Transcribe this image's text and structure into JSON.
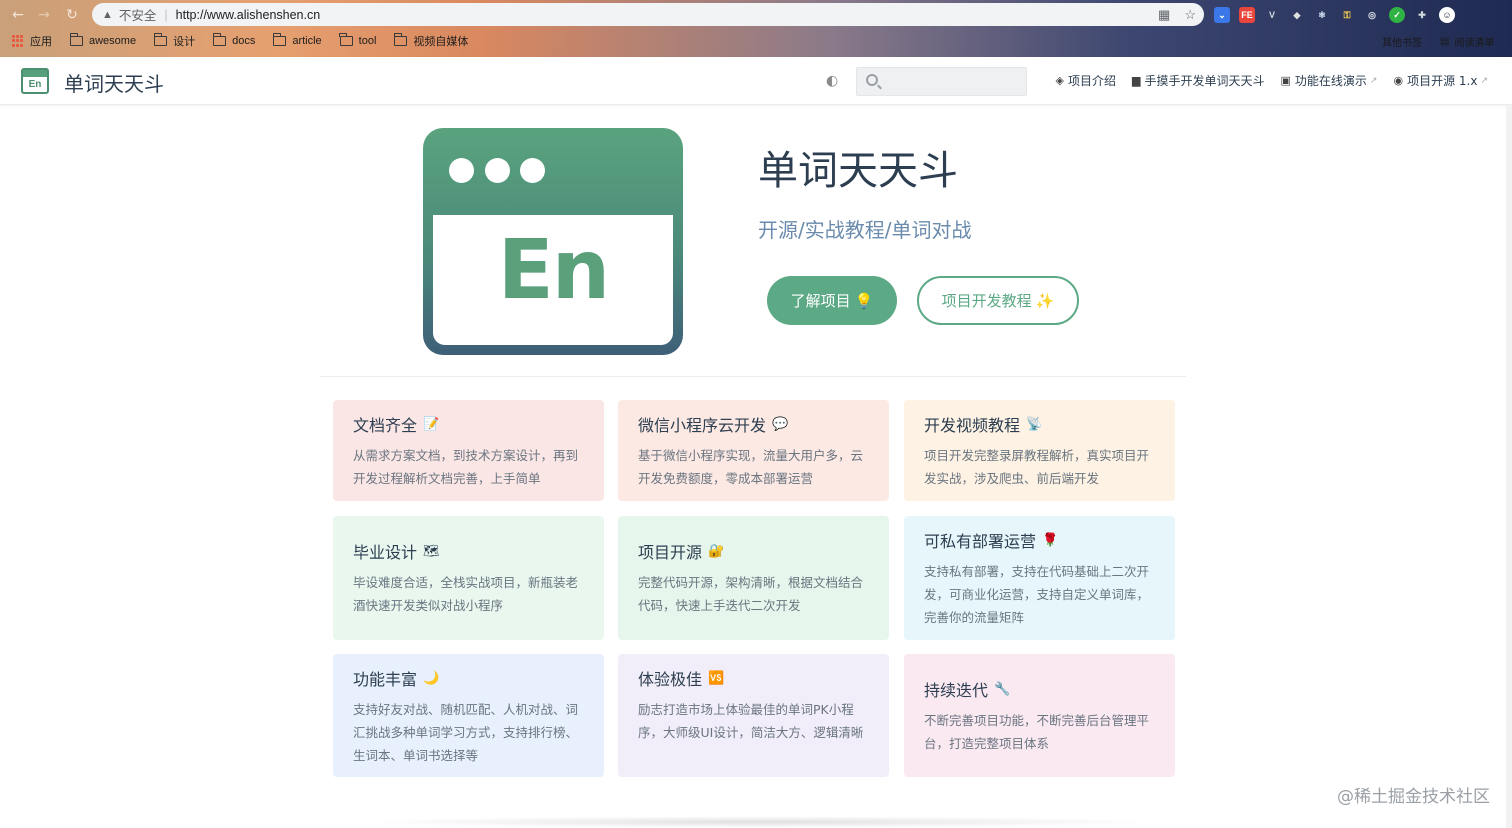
{
  "browser": {
    "insecure_label": "不安全",
    "url": "http://www.alishenshen.cn",
    "bookmarks": [
      {
        "label": "应用",
        "icon": "apps-grid-icon"
      },
      {
        "label": "awesome",
        "icon": "folder-icon"
      },
      {
        "label": "设计",
        "icon": "folder-icon"
      },
      {
        "label": "docs",
        "icon": "folder-icon"
      },
      {
        "label": "article",
        "icon": "folder-icon"
      },
      {
        "label": "tool",
        "icon": "folder-icon"
      },
      {
        "label": "视频自媒体",
        "icon": "folder-icon"
      }
    ],
    "other_bookmarks": "其他书签",
    "reading_list": "阅读清单"
  },
  "site": {
    "title": "单词天天斗",
    "logo_text": "En",
    "search_placeholder": "",
    "nav": [
      {
        "label": "项目介绍",
        "icon": "compass-icon",
        "external": false
      },
      {
        "label": "手摸手开发单词天天斗",
        "icon": "book-icon",
        "external": false
      },
      {
        "label": "功能在线演示",
        "icon": "demo-icon",
        "external": true
      },
      {
        "label": "项目开源 1.x",
        "icon": "github-icon",
        "external": true
      }
    ]
  },
  "hero": {
    "title": "单词天天斗",
    "logo_text": "En",
    "description": "开源/实战教程/单词对战",
    "primary_action": "了解项目 💡",
    "secondary_action": "项目开发教程 ✨"
  },
  "features": [
    {
      "title": "文档齐全",
      "emoji": "📝",
      "desc": "从需求方案文档，到技术方案设计，再到开发过程解析文档完善，上手简单",
      "bg": "#fbe6e6"
    },
    {
      "title": "微信小程序云开发",
      "emoji": "💬",
      "desc": "基于微信小程序实现，流量大用户多，云开发免费额度，零成本部署运营",
      "bg": "#fce9e4"
    },
    {
      "title": "开发视频教程",
      "emoji": "📡",
      "desc": "项目开发完整录屏教程解析，真实项目开发实战，涉及爬虫、前后端开发",
      "bg": "#fdf2e3"
    },
    {
      "title": "毕业设计",
      "emoji": "🗺",
      "desc": "毕设难度合适，全栈实战项目，新瓶装老酒快速开发类似对战小程序",
      "bg": "#e9f7ef"
    },
    {
      "title": "项目开源",
      "emoji": "🔐",
      "desc": "完整代码开源，架构清晰，根据文档结合代码，快速上手迭代二次开发",
      "bg": "#e6f6ec"
    },
    {
      "title": "可私有部署运营",
      "emoji": "🌹",
      "desc": "支持私有部署，支持在代码基础上二次开发，可商业化运营，支持自定义单词库，完善你的流量矩阵",
      "bg": "#e6f6fb"
    },
    {
      "title": "功能丰富",
      "emoji": "🌙",
      "desc": "支持好友对战、随机匹配、人机对战、词汇挑战多种单词学习方式，支持排行榜、生词本、单词书选择等",
      "bg": "#e7f0fc"
    },
    {
      "title": "体验极佳",
      "emoji": "🆚",
      "desc": "励志打造市场上体验最佳的单词PK小程序，大师级UI设计，简洁大方、逻辑清晰",
      "bg": "#f1eef9"
    },
    {
      "title": "持续迭代",
      "emoji": "🔧",
      "desc": "不断完善项目功能，不断完善后台管理平台，打造完整项目体系",
      "bg": "#fbe9f2"
    }
  ],
  "watermark": "@稀土掘金技术社区"
}
